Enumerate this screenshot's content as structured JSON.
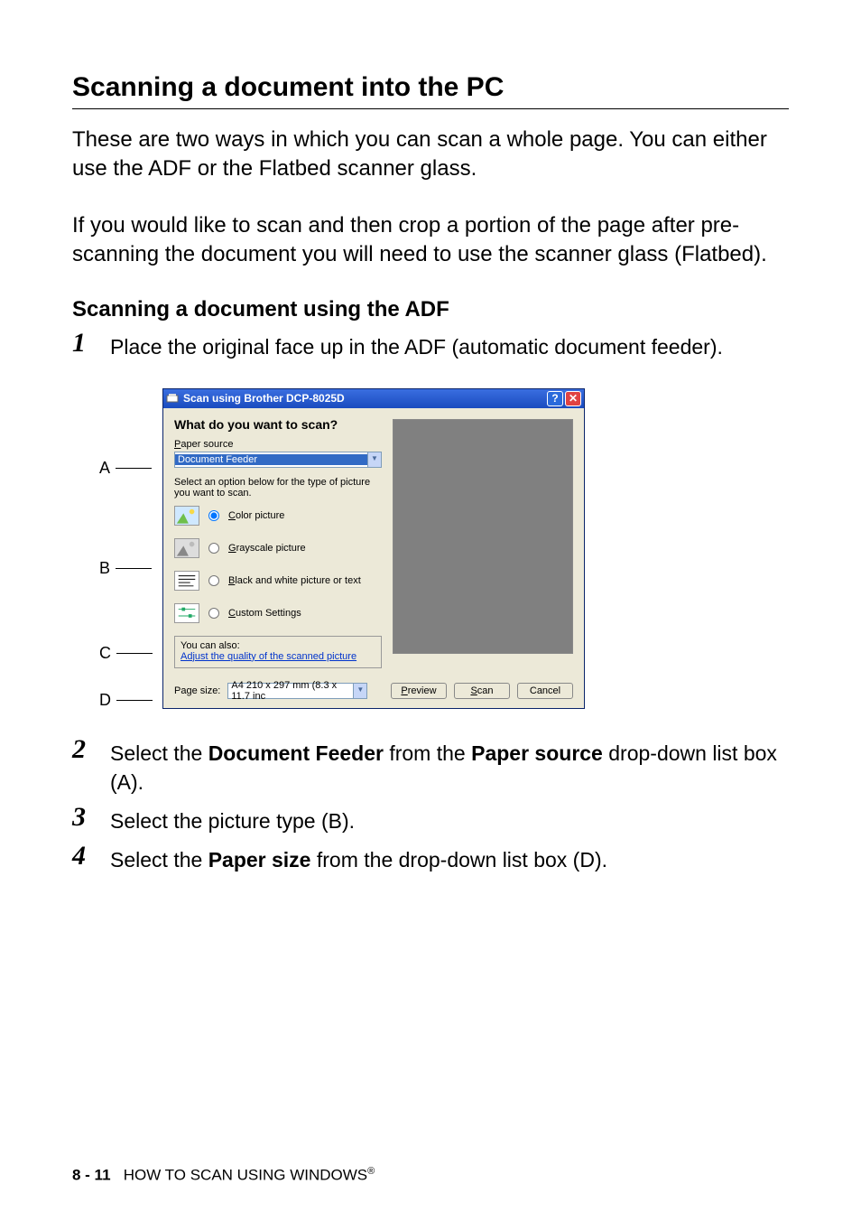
{
  "heading": "Scanning a document into the PC",
  "para1": "These are two ways in which you can scan a whole page. You can either use the ADF or the Flatbed scanner glass.",
  "para2": "If you would like to scan and then crop a portion of the page after pre-scanning the document you will need to use the scanner glass (Flatbed).",
  "subhead": "Scanning a document using the ADF",
  "steps": {
    "s1": "Place the original face up in the ADF (automatic document feeder).",
    "s2_a": "Select the ",
    "s2_b": "Document Feeder",
    "s2_c": " from the ",
    "s2_d": "Paper source",
    "s2_e": " drop-down list box (A).",
    "s3": "Select the picture type (B).",
    "s4_a": "Select the ",
    "s4_b": "Paper size",
    "s4_c": " from the drop-down list box (D)."
  },
  "labels": {
    "A": "A",
    "B": "B",
    "C": "C",
    "D": "D"
  },
  "dialog": {
    "title": "Scan using Brother DCP-8025D",
    "wdys": "What do you want to scan?",
    "paper_source_label_pre": "P",
    "paper_source_label_post": "aper source",
    "paper_source_value": "Document Feeder",
    "instr": "Select an option below for the type of picture you want to scan.",
    "opt_color_pre": "C",
    "opt_color_post": "olor picture",
    "opt_gray_pre": "G",
    "opt_gray_post": "rayscale picture",
    "opt_bw_pre": "B",
    "opt_bw_post": "lack and white picture or text",
    "opt_custom_pre": "C",
    "opt_custom_post": "ustom Settings",
    "adj_text": "You can also:",
    "adj_link": "Adjust the quality of the scanned picture",
    "page_size_label": "Page size:",
    "page_size_value": "A4 210 x 297 mm (8.3 x 11.7 inc",
    "btn_preview_pre": "P",
    "btn_preview_post": "review",
    "btn_scan_pre": "S",
    "btn_scan_post": "can",
    "btn_cancel": "Cancel"
  },
  "footer": {
    "page": "8 - 11",
    "text_a": "HOW TO SCAN USING WINDOWS",
    "text_b": "®"
  }
}
